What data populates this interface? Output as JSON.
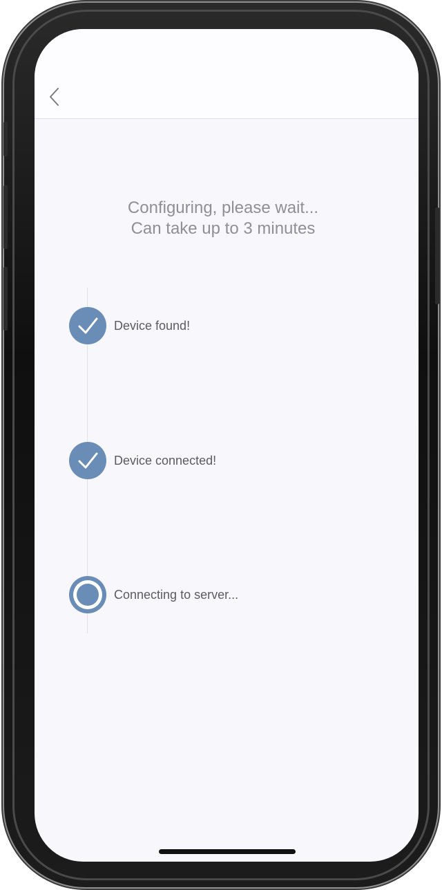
{
  "screen": {
    "title_line_1": "Configuring, please wait...",
    "title_line_2": "Can take up to 3 minutes"
  },
  "nav": {
    "back_icon": "chevron-left-icon"
  },
  "steps": [
    {
      "label": "Device found!",
      "state": "done",
      "icon": "check-circle-icon"
    },
    {
      "label": "Device connected!",
      "state": "done",
      "icon": "check-circle-icon"
    },
    {
      "label": "Connecting to server...",
      "state": "in-progress",
      "icon": "radio-progress-icon"
    }
  ],
  "colors": {
    "accent": "#6a8db8",
    "background": "#f8f7fc",
    "text": "#5b5b60",
    "title_text": "#8f8f94"
  }
}
